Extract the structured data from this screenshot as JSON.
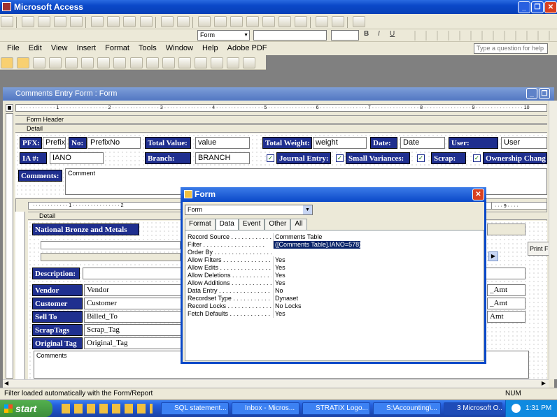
{
  "app": {
    "title": "Microsoft Access"
  },
  "toolbar_format": {
    "object_select": "Form"
  },
  "menu": {
    "items": [
      "File",
      "Edit",
      "View",
      "Insert",
      "Format",
      "Tools",
      "Window",
      "Help",
      "Adobe PDF"
    ],
    "help_placeholder": "Type a question for help"
  },
  "form_window": {
    "title": "Comments Entry Form : Form"
  },
  "sections": {
    "form_header": "Form Header",
    "detail": "Detail"
  },
  "header_fields": {
    "pfx_label": "PFX:",
    "pfx_value": "Prefix",
    "no_label": "No:",
    "no_value": "PrefixNo",
    "total_value_label": "Total Value:",
    "total_value_value": "value",
    "total_weight_label": "Total Weight:",
    "total_weight_value": "weight",
    "date_label": "Date:",
    "date_value": "Date",
    "user_label": "User:",
    "user_value": "User",
    "ia_label": "IA #:",
    "ia_value": "IANO",
    "branch_label": "Branch:",
    "branch_value": "BRANCH",
    "journal_entry_label": "Journal Entry:",
    "small_variances_label": "Small Variances:",
    "scrap_label": "Scrap:",
    "ownership_label": "Ownership Chang",
    "comments_label": "Comments:",
    "comments_value": "Comment"
  },
  "subform": {
    "section": "Detail",
    "company_label": "National Bronze and Metals",
    "description_label": "Description:",
    "rows": [
      {
        "label": "Vendor",
        "value": "Vendor",
        "right": "_Amt"
      },
      {
        "label": "Customer",
        "value": "Customer",
        "right": "_Amt"
      },
      {
        "label": "Sell To",
        "value": "Billed_To",
        "right": "Amt"
      },
      {
        "label": "ScrapTags",
        "value": "Scrap_Tag",
        "right": ""
      },
      {
        "label": "Original Tag",
        "value": "Original_Tag",
        "right": ""
      }
    ],
    "comments_field": "Comments",
    "print_button": "Print F"
  },
  "ruler_numbers": [
    "1",
    "2",
    "3",
    "4",
    "5",
    "6",
    "7",
    "8",
    "9",
    "10"
  ],
  "property_sheet": {
    "title": "Form",
    "object_select": "Form",
    "tabs": [
      "Format",
      "Data",
      "Event",
      "Other",
      "All"
    ],
    "active_tab": "Data",
    "properties": [
      {
        "name": "Record Source",
        "value": "Comments Table"
      },
      {
        "name": "Filter",
        "value": "([Comments Table].IANO=578))"
      },
      {
        "name": "Order By",
        "value": ""
      },
      {
        "name": "Allow Filters",
        "value": "Yes"
      },
      {
        "name": "Allow Edits",
        "value": "Yes"
      },
      {
        "name": "Allow Deletions",
        "value": "Yes"
      },
      {
        "name": "Allow Additions",
        "value": "Yes"
      },
      {
        "name": "Data Entry",
        "value": "No"
      },
      {
        "name": "Recordset Type",
        "value": "Dynaset"
      },
      {
        "name": "Record Locks",
        "value": "No Locks"
      },
      {
        "name": "Fetch Defaults",
        "value": "Yes"
      }
    ]
  },
  "status": {
    "message": "Filter loaded automatically with the Form/Report",
    "num": "NUM"
  },
  "taskbar": {
    "start": "start",
    "tasks": [
      "SQL statement...",
      "Inbox - Micros...",
      "STRATIX Logo...",
      "S:\\Accounting\\...",
      "3 Microsoft O..."
    ],
    "clock": "1:31 PM"
  },
  "colors": {
    "label_bg": "#1f2f8f",
    "title_blue": "#0a48c8",
    "taskbar_blue": "#245edb"
  }
}
